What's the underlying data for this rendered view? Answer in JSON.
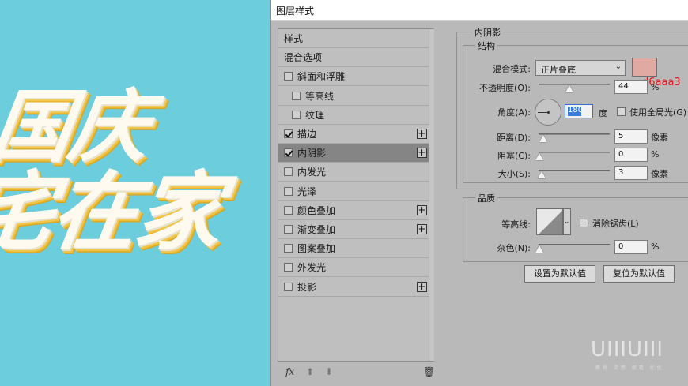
{
  "canvas": {
    "line1": "国庆",
    "line2": "宅在家"
  },
  "dialog": {
    "title": "图层样式",
    "styles_list": [
      {
        "label": "样式",
        "checkbox": false,
        "checked": false,
        "plus": false,
        "indent": false,
        "selected": false
      },
      {
        "label": "混合选项",
        "checkbox": false,
        "checked": false,
        "plus": false,
        "indent": false,
        "selected": false
      },
      {
        "label": "斜面和浮雕",
        "checkbox": true,
        "checked": false,
        "plus": false,
        "indent": false,
        "selected": false
      },
      {
        "label": "等高线",
        "checkbox": true,
        "checked": false,
        "plus": false,
        "indent": true,
        "selected": false
      },
      {
        "label": "纹理",
        "checkbox": true,
        "checked": false,
        "plus": false,
        "indent": true,
        "selected": false
      },
      {
        "label": "描边",
        "checkbox": true,
        "checked": true,
        "plus": true,
        "indent": false,
        "selected": false
      },
      {
        "label": "内阴影",
        "checkbox": true,
        "checked": true,
        "plus": true,
        "indent": false,
        "selected": true
      },
      {
        "label": "内发光",
        "checkbox": true,
        "checked": false,
        "plus": false,
        "indent": false,
        "selected": false
      },
      {
        "label": "光泽",
        "checkbox": true,
        "checked": false,
        "plus": false,
        "indent": false,
        "selected": false
      },
      {
        "label": "颜色叠加",
        "checkbox": true,
        "checked": false,
        "plus": true,
        "indent": false,
        "selected": false
      },
      {
        "label": "渐变叠加",
        "checkbox": true,
        "checked": false,
        "plus": true,
        "indent": false,
        "selected": false
      },
      {
        "label": "图案叠加",
        "checkbox": true,
        "checked": false,
        "plus": false,
        "indent": false,
        "selected": false
      },
      {
        "label": "外发光",
        "checkbox": true,
        "checked": false,
        "plus": false,
        "indent": false,
        "selected": false
      },
      {
        "label": "投影",
        "checkbox": true,
        "checked": false,
        "plus": true,
        "indent": false,
        "selected": false
      }
    ],
    "footer": {
      "fx": "fx",
      "up": "⬆",
      "down": "⬇",
      "trash": "🗑"
    },
    "panel": {
      "section_title": "内阴影",
      "structure_title": "结构",
      "blend_mode_label": "混合模式:",
      "blend_mode_value": "正片叠底",
      "color_swatch": "#e0aaa3",
      "annotation": "d6aaa3",
      "opacity_label": "不透明度(O):",
      "opacity_value": "44",
      "opacity_unit": "%",
      "opacity_level": 44,
      "angle_label": "角度(A):",
      "angle_value": "180",
      "angle_unit": "度",
      "global_light_label": "使用全局光(G)",
      "distance_label": "距离(D):",
      "distance_value": "5",
      "distance_unit": "像素",
      "distance_level": 2,
      "choke_label": "阻塞(C):",
      "choke_value": "0",
      "choke_unit": "%",
      "choke_level": 0,
      "size_label": "大小(S):",
      "size_value": "3",
      "size_unit": "像素",
      "size_level": 2,
      "quality_title": "品质",
      "contour_label": "等高线:",
      "antialias_label": "消除锯齿(L)",
      "noise_label": "杂色(N):",
      "noise_value": "0",
      "noise_unit": "%",
      "noise_level": 0,
      "set_default_button": "设置为默认值",
      "reset_default_button": "复位为默认值"
    },
    "watermark": {
      "logo": "UIIIUIII",
      "sub": "教程 灵感 就看 优优"
    }
  }
}
